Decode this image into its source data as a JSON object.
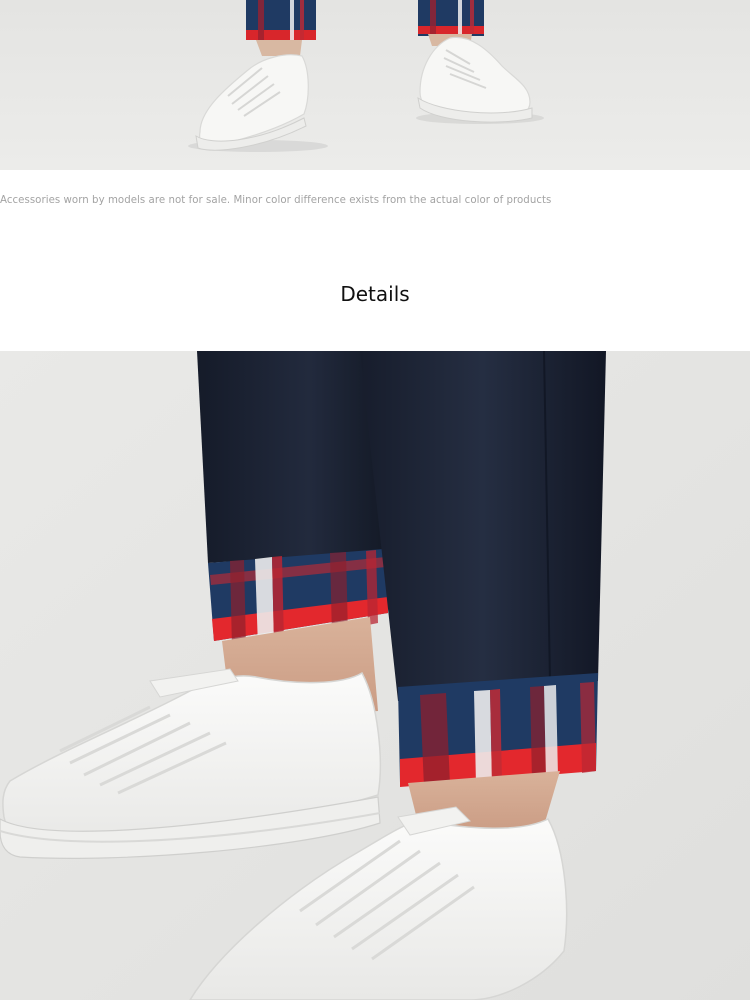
{
  "images": {
    "top_photo": "product-photo-white-sneakers-cuffed-plaid-trousers",
    "detail_photo": "detail-photo-plaid-cuff-and-white-sneakers"
  },
  "disclaimer": {
    "text": "Accessories worn by models are not for sale. Minor color difference exists from the actual color of products"
  },
  "details_section": {
    "title": "Details"
  },
  "colors": {
    "navy": "#1b2233",
    "plaid_red": "#d8262b",
    "plaid_blue": "#1f3a63",
    "sneaker_white": "#f7f7f5",
    "backdrop": "#e6e6e4"
  }
}
